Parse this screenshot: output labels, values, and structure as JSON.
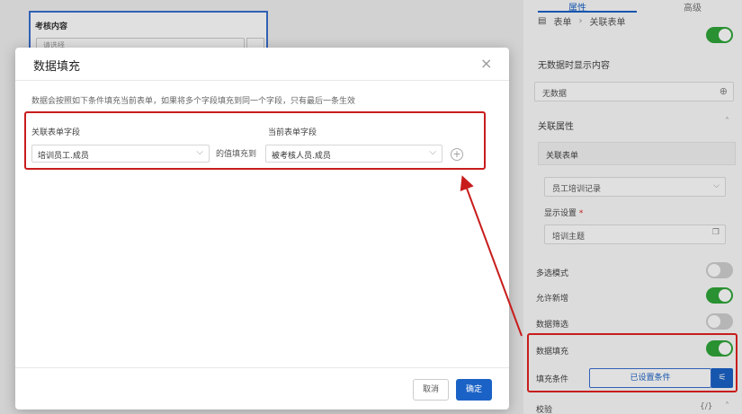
{
  "background_form": {
    "section_title": "考核内容",
    "input_placeholder": "请选择"
  },
  "right_panel": {
    "tabs": [
      "属性",
      "高级"
    ],
    "breadcrumb": [
      "表单",
      "关联表单"
    ],
    "no_data_label": "无数据时显示内容",
    "no_data_value": "无数据",
    "assoc_props_label": "关联属性",
    "assoc_form_label": "关联表单",
    "assoc_form_value": "员工培训记录",
    "display_settings_label": "显示设置",
    "required_mark": "*",
    "display_value": "培训主题",
    "multi_select_label": "多选模式",
    "allow_add_label": "允许新增",
    "data_filter_label": "数据筛选",
    "data_fill_label": "数据填充",
    "fill_condition_label": "填充条件",
    "fill_condition_button": "已设置条件",
    "validation_label": "校验",
    "code_icon": "{/}",
    "toggles": {
      "multi_select": false,
      "allow_add": true,
      "data_filter": false,
      "data_fill": true
    }
  },
  "modal": {
    "title": "数据填充",
    "close_icon": "×",
    "description": "数据会按照如下条件填充当前表单，如果将多个字段填充到同一个字段，只有最后一条生效",
    "assoc_field_label": "关联表单字段",
    "current_field_label": "当前表单字段",
    "assoc_field_value": "培训员工.成员",
    "fill_to_text": "的值填充到",
    "current_field_value": "被考核人员.成员",
    "cancel_label": "取消",
    "confirm_label": "确定"
  },
  "colors": {
    "accent": "#1b62c6",
    "toggle_on": "#2fa53a",
    "highlight": "#c81c1c"
  }
}
